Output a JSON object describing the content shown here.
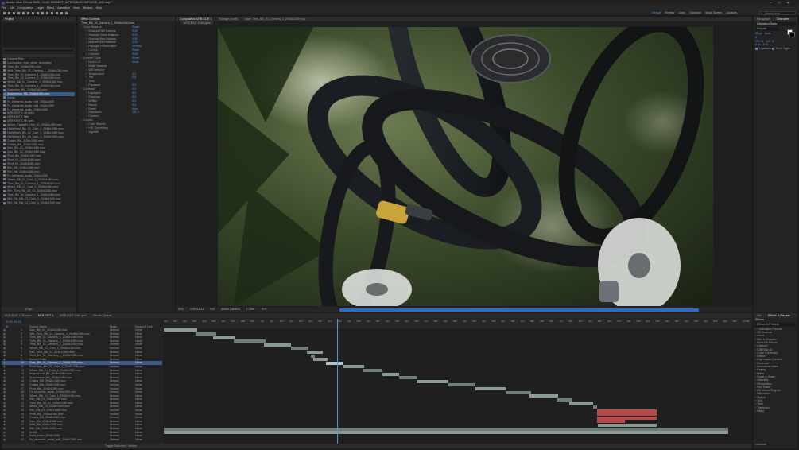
{
  "title_bar": {
    "title": "Adobe After Effects 2020 - D:\\05 2020\\ELT_INTERVAL\\COMP\\H!SE_A00.aep *",
    "controls": [
      "–",
      "□",
      "✕"
    ]
  },
  "menu": [
    "File",
    "Edit",
    "Composition",
    "Layer",
    "Effect",
    "Animation",
    "View",
    "Window",
    "Help"
  ],
  "toolbar": {
    "workspaces": [
      "Default",
      "Review",
      "Learn",
      "Standard",
      "Small Screen",
      "Libraries"
    ],
    "search_placeholder": "Search Help"
  },
  "project_panel": {
    "tab": "Project",
    "items": [
      "Camera Rigs",
      "Locomotion_legs_remix_animating",
      "Tires_Blk_3048x1080.mov",
      "Wlbt_Tires_Blk_01_Camera_1_2048x1080.mov",
      "Tires_Blk_01_Camera_1_2048x1080.mov",
      "Tires_Blk_02_Camera_2_2048x1080.mov",
      "Wheel_Blk_01_Camera_1_2048x1080.mov",
      "Tires_Blk_01_Camera_1_2048x1080.mov",
      "Rockshox_Blk_2048x1080.mov",
      "Suspension_Blk_2048x1080.mov",
      "Solids",
      "Fx_elements_audio_edit_2048x1080",
      "Fx_elements_audio_edit_2048x1080",
      "Fx_elements_audio_2048x1080",
      "MTB EDIT 1 4K spec",
      "MTB EDIT 1 Title",
      "MTB EDIT 1 4K spec",
      "Wheel_Cassette_Hub_01_2048x1080.mov",
      "HubWheel_Blk_01_Cam_1_2048x1080.mov",
      "HubWheel_Blk_02_Cam_2_2048x1080.mov",
      "HubWheel_Blk_03_Cam_3_2048x1080.mov",
      "Chains_Blk_2048x1080.mov",
      "Chains_Blk_2048x1080.mov",
      "Disc_Blk_01_2048x1080.mov",
      "Disc_Blk_02_2048x1080.mov",
      "Pivot_Blk_2048x1080.mov",
      "Pivot_03_2048x1080.mov",
      "Pivot_04_2048x1080.mov",
      "Rim_Blk_2048x1080.mov",
      "Rim_Blk_2048x1080.mov",
      "Fx_elements_audio_2048x1080",
      "Wheel_Blk_01_Cam_1_2048x1080.mov",
      "Tires_Blk_01_Camera_1_2048x1080.mov",
      "Wheel_Blk_01_Cam_1_2048x1080.mov",
      "Rim_Tires_Blk_Alt_01_2048x1080.mov",
      "Tires_Blk_01_Camera_1_2048x1080.mov",
      "Wbt_Blk_Blk_01_Cam_1_2048x1080.mov",
      "Rim_Blk_Blk_01_Cam_1_2048x1080.mov"
    ],
    "selected_index": 9,
    "footer_label": "8 bpc"
  },
  "effect_controls": {
    "tab": "Effect Controls",
    "layer": "Tires_Blk_01_Camera_1_2048x1080.mov",
    "rows": [
      {
        "label": "Color Balance",
        "value": "Reset"
      },
      {
        "label": "Shadow Red Balance",
        "value": "0.00"
      },
      {
        "label": "Shadow Green Balance",
        "value": "0.00"
      },
      {
        "label": "Shadow Blue Balance",
        "value": "0.00"
      },
      {
        "label": "Midtone Red Balance",
        "value": "0.00"
      },
      {
        "label": "Highlight Preservation",
        "value": "Normal"
      },
      {
        "label": "Curves",
        "value": "Reset"
      },
      {
        "label": "Channel",
        "value": "RGB"
      },
      {
        "label": "Lumetri Color",
        "value": "Reset"
      },
      {
        "label": "Input LUT",
        "value": "None"
      },
      {
        "label": "White Balance",
        "value": ""
      },
      {
        "label": "WB Selector",
        "value": ""
      },
      {
        "label": "Temperature",
        "value": "0.0"
      },
      {
        "label": "Tint",
        "value": "0.0"
      },
      {
        "label": "Tone",
        "value": ""
      },
      {
        "label": "Exposure",
        "value": "0.0"
      },
      {
        "label": "Contrast",
        "value": "0.0"
      },
      {
        "label": "Highlights",
        "value": "0.0"
      },
      {
        "label": "Shadows",
        "value": "0.0"
      },
      {
        "label": "Whites",
        "value": "0.0"
      },
      {
        "label": "Blacks",
        "value": "0.0"
      },
      {
        "label": "Reset",
        "value": "Auto"
      },
      {
        "label": "Saturation",
        "value": "100.0"
      },
      {
        "label": "Creative",
        "value": ""
      },
      {
        "label": "Curves",
        "value": ""
      },
      {
        "label": "Color Wheels",
        "value": ""
      },
      {
        "label": "HSL Secondary",
        "value": ""
      },
      {
        "label": "Vignette",
        "value": ""
      }
    ]
  },
  "composition": {
    "tabs": [
      "Composition MTB EDIT 1",
      "Footage (none)",
      "Layer Tires_Blk_01_Camera_1_2048x1080.mov"
    ],
    "breadcrumb": "MTB EDIT 1 4K spec",
    "footer": {
      "zoom": "50%",
      "time": "0:00:03:23",
      "quality": "Full",
      "camera": "Active Camera",
      "views": "1 View",
      "offset": "+0.0"
    }
  },
  "right_panel": {
    "tabs": [
      "Paragraph",
      "Character"
    ],
    "font": "Liberation Sans",
    "style": "Regular",
    "size": "48 px",
    "leading": "Auto",
    "tracking": "0",
    "scale_v": "100 %",
    "scale_h": "100 %",
    "baseline": "0 px",
    "tsume": "0 %",
    "ligatures": "Ligatures",
    "hindi_digits": "Hindi Digits",
    "lower_tabs": [
      "Info",
      "Effects & Presets"
    ],
    "lower_list_title": "Effects",
    "lower_list_filter": "Effects & Presets",
    "lower_list": [
      "* Animation Presets",
      "3D Channel",
      "Audio",
      "Blur & Sharpen",
      "Boris FX Mocha",
      "Channel",
      "CINEMA 4D",
      "Color Correction",
      "Distort",
      "Expression Controls",
      "Generate",
      "Immersive Video",
      "Keying",
      "Matte",
      "Noise & Grain",
      "Obsolete",
      "Perspective",
      "Red Giant",
      "RE:Vision Plug-ins",
      "Simulation",
      "Stylize",
      "Text",
      "Time",
      "Transition",
      "Utility"
    ],
    "bottom_label": "Libraries"
  },
  "timeline": {
    "tabs": [
      "MTB EDIT 1 4K spec",
      "MTB EDIT 1",
      "MTB EDIT 1 4K spec",
      "Render Queue"
    ],
    "timecode": "0:00:03:23",
    "columns": [
      "#",
      "Source Name",
      "Mode",
      "Parent & Link"
    ],
    "layers": [
      "Disc_Blk_01_2048x1080.mov",
      "Wbt_Tires_Blk_01_Camera_1_2048x1080.mov",
      "Tires_Blk_01_Camera_1_2048x1080.mov",
      "Tires_Blk_01_Camera_2_2048x1080.mov",
      "Tires_Blk_02_Camera_2_2048x1080.mov",
      "Wheel_Blk_01_Cam_1_2048x1080.mov",
      "Rim_Tires_Blk_01_2048x1080.mov",
      "Tires_Blk_01_Camera_1_2048x1080.mov",
      "Lumetri Color",
      "Tires_Blk_01_Camera_1_2048x1080.mov",
      "Rockshox_Blk_01_Cam_1_2048x1080.mov",
      "Wheel_Blk_01_Cam_1_2048x1080.mov",
      "Suspension_Blk_2048x1080.mov",
      "Suspension_Blk_2048x1080.mov",
      "Chains_Blk_2048x1080.mov",
      "Chains_Blk_2048x1080.mov",
      "Pivot_Blk_2048x1080.mov",
      "Fx_elements_audio_2048x1080.mov",
      "Wheel_Blk_01_Cam_1_2048x1080.mov",
      "Rim_Blk_01_2048x1080.mov",
      "Tires_Blk_Alt_01_2048x1080.mov",
      "Wheel_Blk_01_2048x1080.mov",
      "Rim_Blk_01_2048x1080.mov",
      "Pivot_Blk_2048x1080.mov",
      "Chains_Blk_2048x1080.mov",
      "Disc_Blk_2048x1080.mov",
      "Wlbt_Blk_2048x1080.mov",
      "Rim_Blk_2048x1080.mov",
      "Solids",
      "Solid_black_2048x1080",
      "Fx_elements_audio_edit_2048x1080.wav"
    ],
    "mode_value": "Normal",
    "parent_value": "None",
    "ruler_labels": [
      "00s",
      "01s",
      "02s",
      "03s",
      "04s",
      "05s",
      "06s",
      "07s",
      "08s",
      "09s",
      "10s",
      "11s",
      "12s",
      "13s",
      "14s",
      "15s",
      "16s",
      "17s",
      "18s",
      "19s",
      "20s",
      "21s",
      "22s",
      "23s",
      "24s",
      "25s",
      "26s",
      "27s",
      "28s",
      "29s",
      "30s",
      "31s",
      "32s",
      "33s",
      "34s",
      "35s",
      "36s",
      "37s",
      "38s",
      "39s",
      "40s",
      "41s",
      "42s",
      "43s",
      "44s",
      "45s",
      "46s",
      "47s",
      "48s",
      "49s",
      "50s",
      "51s",
      "52s",
      "53s",
      "54s",
      "55s",
      "56s",
      "57s",
      "58s",
      "59s",
      "01:00f"
    ],
    "footer": "Toggle Switches / Modes",
    "colors": {
      "clip": "#8a9a94",
      "clip_dark": "#6f7d78",
      "selected_clip": "#a9c3cf",
      "red_clip": "#b54b4b",
      "playhead": "#4a95e6"
    }
  }
}
